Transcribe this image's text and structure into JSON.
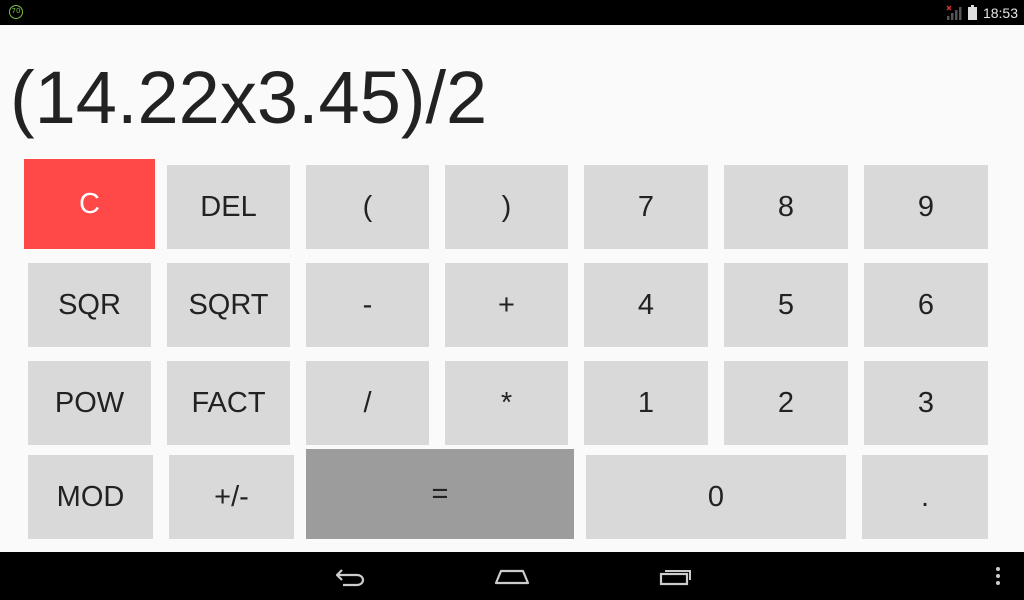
{
  "status_bar": {
    "app_icon_text": "70",
    "time": "18:53",
    "icons": [
      "app-notification-icon",
      "signal-icon",
      "battery-icon"
    ]
  },
  "display": {
    "expression": "(14.22x3.45)/2"
  },
  "keys": {
    "clear": "C",
    "del": "DEL",
    "lparen": "(",
    "rparen": ")",
    "seven": "7",
    "eight": "8",
    "nine": "9",
    "sqr": "SQR",
    "sqrt": "SQRT",
    "minus": "-",
    "plus": "+",
    "four": "4",
    "five": "5",
    "six": "6",
    "pow": "POW",
    "fact": "FACT",
    "divide": "/",
    "multiply": "*",
    "one": "1",
    "two": "2",
    "three": "3",
    "mod": "MOD",
    "negate": "+/-",
    "equals": "=",
    "zero": "0",
    "decimal": "."
  },
  "colors": {
    "clear_key": "#ff4949",
    "key": "#d9d9d9",
    "equals_key": "#9c9c9c",
    "background": "#fafafa",
    "bars": "#000000"
  },
  "nav_bar": {
    "icons": [
      "back-icon",
      "home-icon",
      "recents-icon",
      "overflow-menu-icon"
    ]
  }
}
